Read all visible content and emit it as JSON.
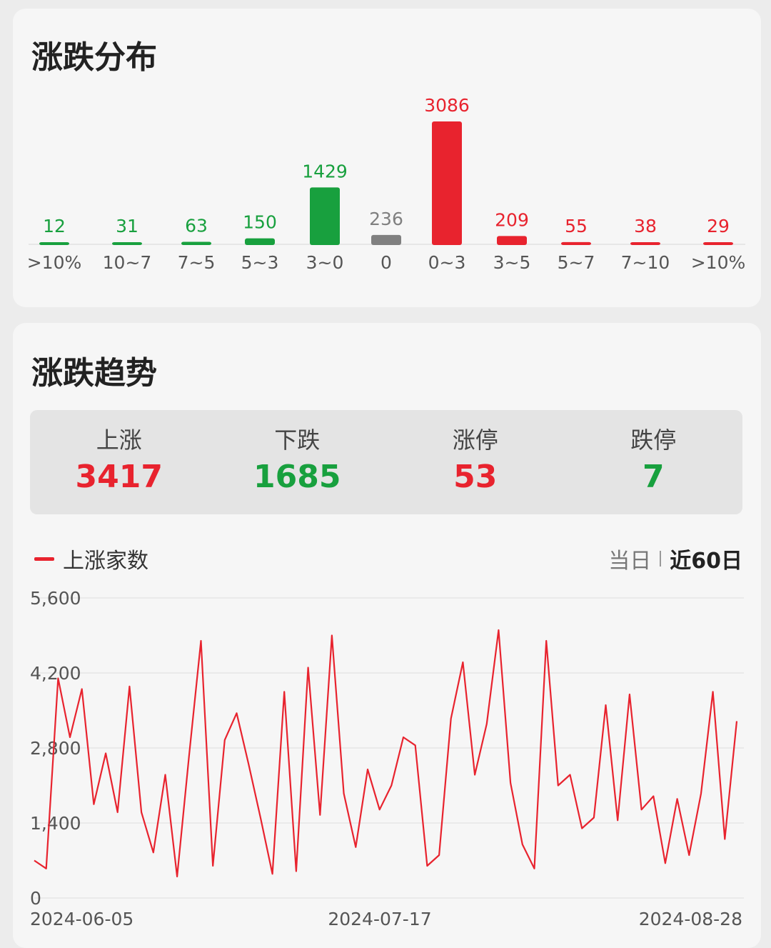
{
  "distribution": {
    "title": "涨跌分布",
    "bars": [
      {
        "label": ">10%",
        "value": 12,
        "color": "#18a03e"
      },
      {
        "label": "10~7",
        "value": 31,
        "color": "#18a03e"
      },
      {
        "label": "7~5",
        "value": 63,
        "color": "#18a03e"
      },
      {
        "label": "5~3",
        "value": 150,
        "color": "#18a03e"
      },
      {
        "label": "3~0",
        "value": 1429,
        "color": "#18a03e"
      },
      {
        "label": "0",
        "value": 236,
        "color": "#808080"
      },
      {
        "label": "0~3",
        "value": 3086,
        "color": "#e8232e"
      },
      {
        "label": "3~5",
        "value": 209,
        "color": "#e8232e"
      },
      {
        "label": "5~7",
        "value": 55,
        "color": "#e8232e"
      },
      {
        "label": "7~10",
        "value": 38,
        "color": "#e8232e"
      },
      {
        "label": ">10%",
        "value": 29,
        "color": "#e8232e"
      }
    ]
  },
  "trend": {
    "title": "涨跌趋势",
    "stats": [
      {
        "label": "上涨",
        "value": "3417",
        "color": "red"
      },
      {
        "label": "下跌",
        "value": "1685",
        "color": "green"
      },
      {
        "label": "涨停",
        "value": "53",
        "color": "red"
      },
      {
        "label": "跌停",
        "value": "7",
        "color": "green"
      }
    ],
    "legend_label": "上涨家数",
    "range_options": [
      "当日",
      "近60日"
    ],
    "range_selected": "近60日"
  },
  "chart_data": {
    "type": "line",
    "series": [
      {
        "name": "上涨家数",
        "color": "#e8232e",
        "values": [
          700,
          550,
          4100,
          3000,
          3900,
          1750,
          2700,
          1600,
          3950,
          1600,
          850,
          2300,
          400,
          2650,
          4800,
          600,
          2950,
          3450,
          2500,
          1500,
          450,
          3850,
          500,
          4300,
          1550,
          4900,
          1950,
          950,
          2400,
          1650,
          2100,
          3000,
          2850,
          600,
          800,
          3350,
          4400,
          2300,
          3250,
          5000,
          2150,
          1000,
          550,
          4800,
          2100,
          2300,
          1300,
          1500,
          3600,
          1450,
          3800,
          1650,
          1900,
          650,
          1850,
          800,
          1950,
          3850,
          1100,
          3300
        ]
      }
    ],
    "y_ticks": [
      "5,600",
      "4,200",
      "2,800",
      "1,400",
      "0"
    ],
    "ylim": [
      0,
      5600
    ],
    "x_labels": [
      "2024-06-05",
      "2024-07-17",
      "2024-08-28"
    ],
    "grid": true
  }
}
